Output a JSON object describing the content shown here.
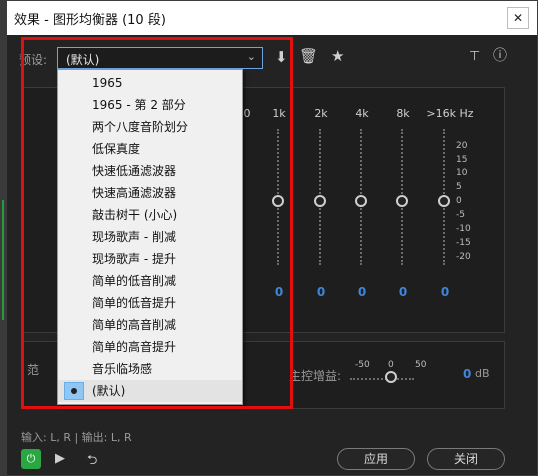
{
  "window": {
    "title": "效果 - 图形均衡器 (10 段)",
    "close_glyph": "✕"
  },
  "preset": {
    "label": "预设:",
    "selected": "(默认)",
    "options": [
      "1965",
      "1965 - 第 2 部分",
      "两个八度音阶划分",
      "低保真度",
      "快速低通滤波器",
      "快速高通滤波器",
      "敲击树干 (小心)",
      "现场歌声 - 削减",
      "现场歌声 - 提升",
      "简单的低音削减",
      "简单的低音提升",
      "简单的高音削减",
      "简单的高音提升",
      "音乐临场感",
      "(默认)"
    ]
  },
  "toolbar": {
    "icons": [
      "download-icon",
      "trash-icon",
      "star-icon",
      "routing-icon",
      "info-icon"
    ]
  },
  "eq": {
    "visible_band_labels": [
      "0",
      "1k",
      "2k",
      "4k",
      "8k",
      ">16k Hz"
    ],
    "band_values": [
      "0",
      "0",
      "0",
      "0",
      "0"
    ],
    "scale": [
      "20",
      "15",
      "10",
      "5",
      "0",
      "-5",
      "-10",
      "-15",
      "-20"
    ]
  },
  "bottom": {
    "range_label": "范",
    "master_gain_label": "主控增益:",
    "gain_scale": [
      "-50",
      "0",
      "50"
    ],
    "gain_value": "0",
    "gain_unit": "dB"
  },
  "io": {
    "label": "输入: L, R | 输出: L, R"
  },
  "buttons": {
    "apply": "应用",
    "close": "关闭"
  },
  "colors": {
    "accent_value": "#3f86d9",
    "power_on": "#2aa742",
    "highlight": "#e01010"
  }
}
